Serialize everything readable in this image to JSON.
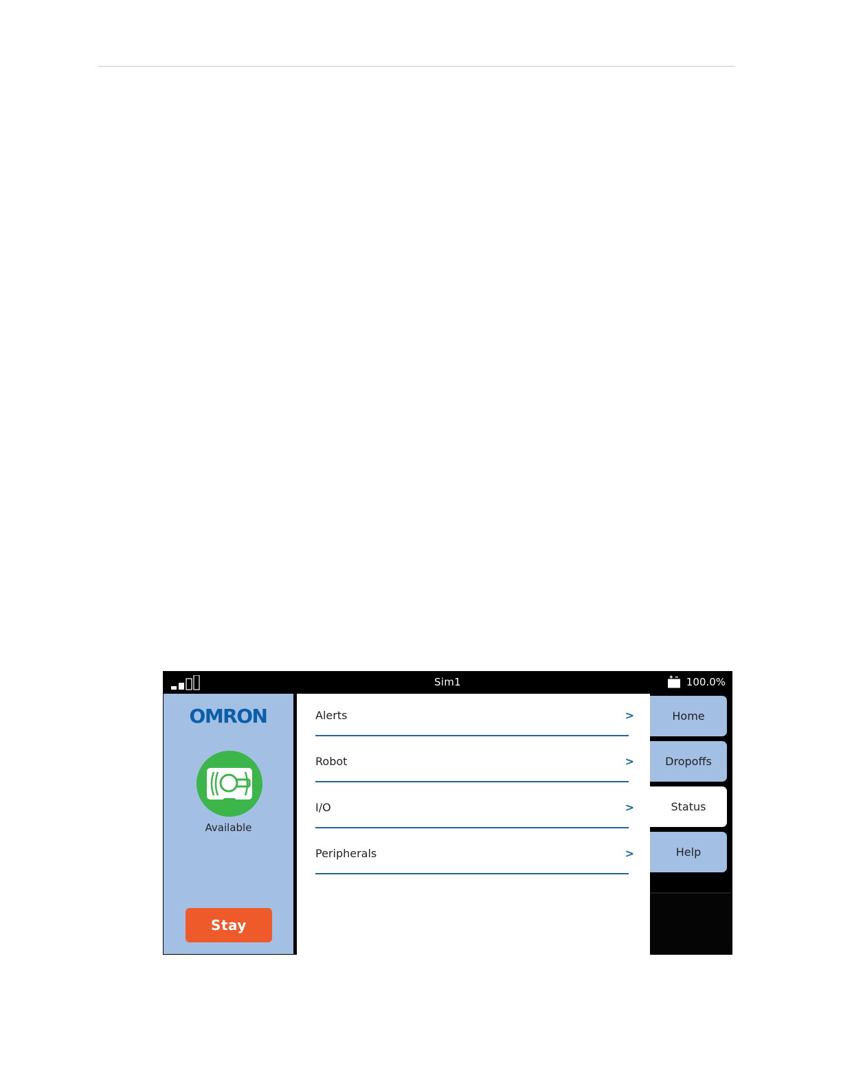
{
  "status_bar": {
    "title": "Sim1",
    "battery_percent": "100.0%",
    "signal_icon": "signal-strength-icon",
    "battery_icon": "battery-charging-icon"
  },
  "left_panel": {
    "logo_text": "OMRON",
    "robot_icon": "robot-status-icon",
    "robot_state": "Available",
    "stay_button_label": "Stay"
  },
  "menu": {
    "items": [
      {
        "label": "Alerts",
        "chevron": ">"
      },
      {
        "label": "Robot",
        "chevron": ">"
      },
      {
        "label": "I/O",
        "chevron": ">"
      },
      {
        "label": "Peripherals",
        "chevron": ">"
      }
    ]
  },
  "nav": {
    "tabs": [
      {
        "label": "Home",
        "active": false
      },
      {
        "label": "Dropoffs",
        "active": false
      },
      {
        "label": "Status",
        "active": true
      },
      {
        "label": "Help",
        "active": false
      }
    ]
  },
  "colors": {
    "panel_blue": "#a3bfe3",
    "accent_line": "#22668f",
    "stay_orange": "#ee5a2a",
    "status_green": "#3cb54a",
    "logo_blue": "#0a5fa8"
  }
}
